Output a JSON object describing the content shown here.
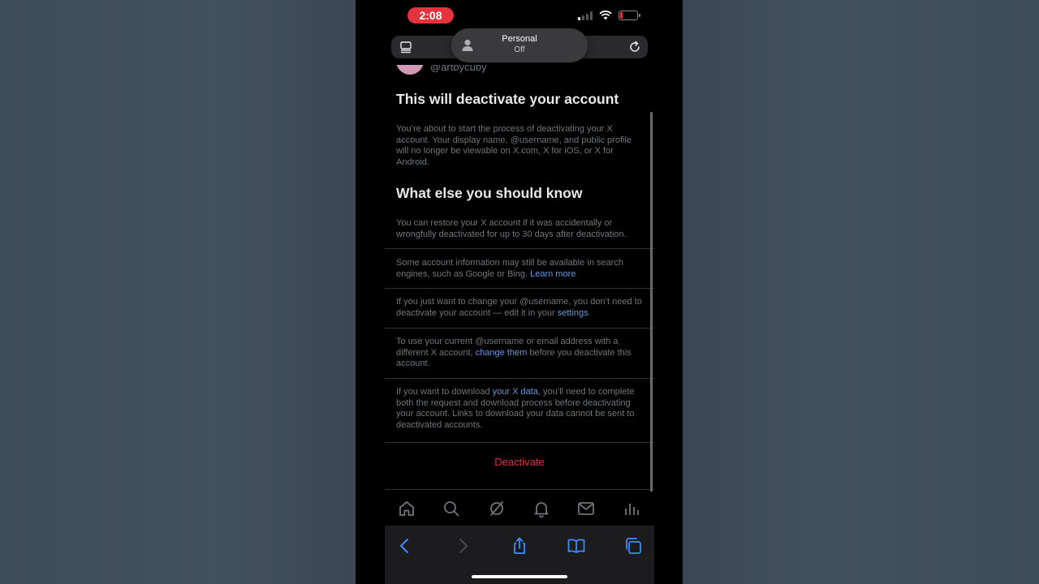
{
  "status_bar": {
    "time": "2:08"
  },
  "browser": {
    "profile_name": "Personal",
    "profile_status": "Off"
  },
  "account": {
    "handle": "@artbycuby"
  },
  "page": {
    "title": "This will deactivate your account",
    "intro": "You’re about to start the process of deactivating your X account. Your display name, @username, and public profile will no longer be viewable on X.com, X for iOS, or X for Android.",
    "section_title": "What else you should know",
    "items": {
      "restore": "You can restore your X account if it was accidentally or wrongfully deactivated for up to 30 days after deactivation.",
      "search_text": "Some account information may still be available in search engines, such as Google or Bing.",
      "search_link": "Learn more",
      "username_text": "If you just want to change your @username, you don’t need to deactivate your account — edit it in your",
      "username_link": "settings",
      "username_end": ".",
      "email_text": "To use your current @username or email address with a different X account,",
      "email_link": "change them",
      "email_end": "before you deactivate this account.",
      "data_text": "If you want to download",
      "data_link": "your X data",
      "data_end": ", you’ll need to complete both the request and download process before deactivating your account. Links to download your data cannot be sent to deactivated accounts."
    },
    "deactivate_label": "Deactivate"
  },
  "colors": {
    "accent_link": "#6a98d8",
    "danger": "#e0303c",
    "status_pill": "#e5323f"
  },
  "icons": {
    "tabbar": [
      "home-icon",
      "search-icon",
      "grok-icon",
      "bell-icon",
      "mail-icon",
      "stats-icon"
    ],
    "toolbar": [
      "back-icon",
      "forward-icon",
      "share-icon",
      "bookmarks-icon",
      "tabs-icon"
    ]
  }
}
